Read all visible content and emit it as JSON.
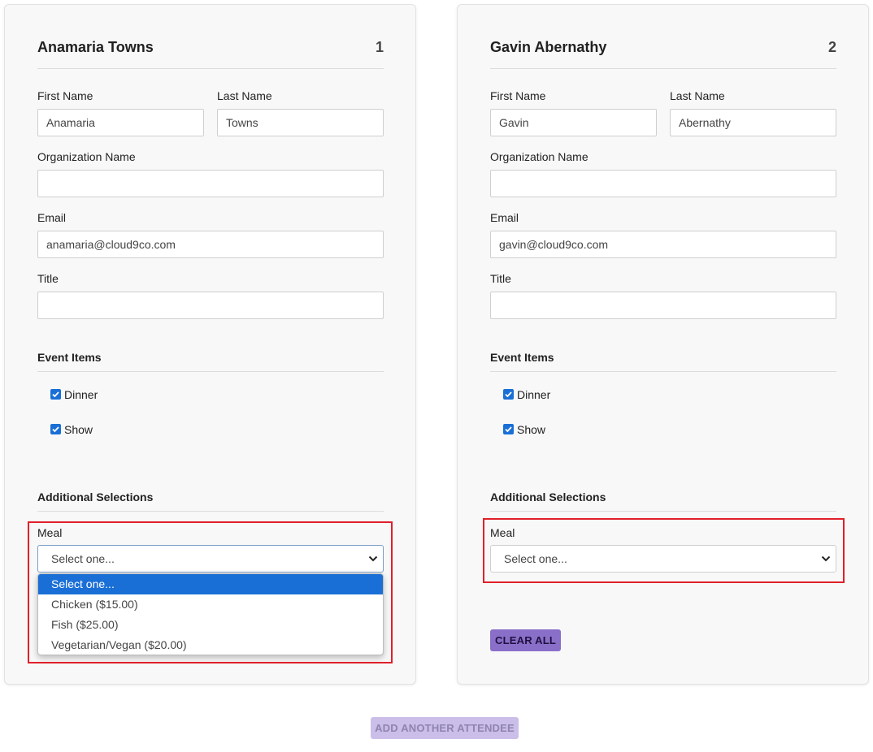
{
  "attendees": [
    {
      "name": "Anamaria Towns",
      "number": "1",
      "first_name_label": "First Name",
      "first_name": "Anamaria",
      "last_name_label": "Last Name",
      "last_name": "Towns",
      "organization_label": "Organization Name",
      "organization": "",
      "email_label": "Email",
      "email": "anamaria@cloud9co.com",
      "title_label": "Title",
      "title": "",
      "event_items_heading": "Event Items",
      "event_items": [
        {
          "label": "Dinner",
          "checked": true
        },
        {
          "label": "Show",
          "checked": true
        }
      ],
      "additional_heading": "Additional Selections",
      "meal_label": "Meal",
      "meal_value": "Select one...",
      "dropdown_open": true
    },
    {
      "name": "Gavin Abernathy",
      "number": "2",
      "first_name_label": "First Name",
      "first_name": "Gavin",
      "last_name_label": "Last Name",
      "last_name": "Abernathy",
      "organization_label": "Organization Name",
      "organization": "",
      "email_label": "Email",
      "email": "gavin@cloud9co.com",
      "title_label": "Title",
      "title": "",
      "event_items_heading": "Event Items",
      "event_items": [
        {
          "label": "Dinner",
          "checked": true
        },
        {
          "label": "Show",
          "checked": true
        }
      ],
      "additional_heading": "Additional Selections",
      "meal_label": "Meal",
      "meal_value": "Select one...",
      "dropdown_open": false,
      "clear_all_label": "CLEAR ALL"
    }
  ],
  "meal_options": [
    "Select one...",
    "Chicken ($15.00)",
    "Fish ($25.00)",
    "Vegetarian/Vegan ($20.00)"
  ],
  "selected_option_index": 0,
  "add_attendee_label": "ADD ANOTHER ATTENDEE",
  "colors": {
    "accent": "#8a6fc9",
    "accent_disabled": "#cbbfe9",
    "highlight": "#e0202a",
    "checkbox": "#1a6fd6"
  }
}
